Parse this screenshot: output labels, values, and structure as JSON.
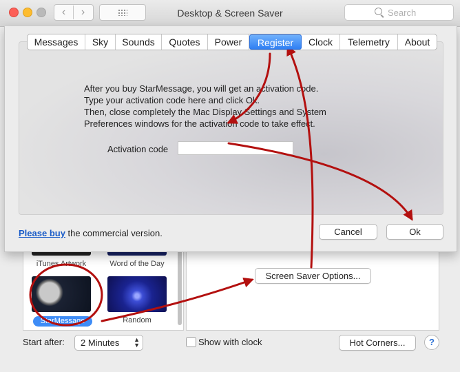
{
  "window": {
    "title": "Desktop & Screen Saver",
    "search_placeholder": "Search"
  },
  "background_pane": {
    "thumbnails": [
      "iTunes Artwork",
      "Word of the Day",
      "StarMessage",
      "Random"
    ],
    "selected": "StarMessage",
    "screen_saver_options_label": "Screen Saver Options...",
    "start_after_label": "Start after:",
    "start_after_value": "2 Minutes",
    "show_with_clock_label": "Show with clock",
    "show_with_clock_checked": false,
    "hot_corners_label": "Hot Corners...",
    "help_label": "?"
  },
  "sheet": {
    "tabs": [
      "Messages",
      "Sky",
      "Sounds",
      "Quotes",
      "Power",
      "Register",
      "Clock",
      "Telemetry",
      "About"
    ],
    "active_tab": "Register",
    "info_lines": [
      "After you buy StarMessage, you will get an activation code.",
      "Type your activation code here and click Ok.",
      "Then, close completely the Mac Display Settings and System",
      "Preferences windows for the activation code to take effect."
    ],
    "activation_label": "Activation code",
    "activation_value": "",
    "please_buy_link": "Please buy",
    "commercial_text": " the commercial version.",
    "cancel_label": "Cancel",
    "ok_label": "Ok"
  },
  "colors": {
    "accent": "#3e8cf6",
    "annotation": "#b3100f",
    "link": "#1a5cc8"
  }
}
